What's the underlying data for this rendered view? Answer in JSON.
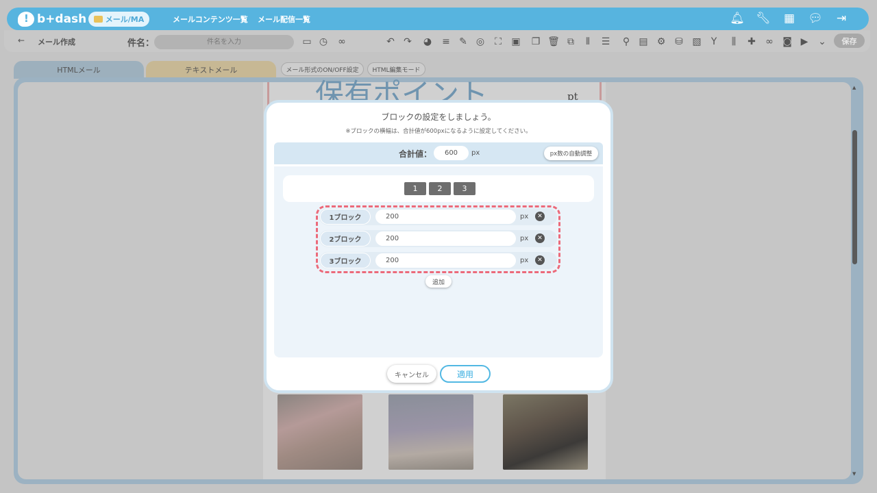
{
  "app": {
    "logo_text": "b+dash",
    "nav_pill": "メール/MA",
    "nav_links": [
      "メールコンテンツ一覧",
      "メール配信一覧"
    ],
    "top_icons": [
      "bell-icon",
      "wrench-icon",
      "grid-icon",
      "chat-icon",
      "logout-icon"
    ]
  },
  "subbar": {
    "back_glyph": "←",
    "page_title": "メール作成",
    "subject_label": "件名：",
    "subject_placeholder": "件名を入力",
    "save_label": "保存"
  },
  "tabs": {
    "html": "HTMLメール",
    "text": "テキストメール",
    "toggle_format": "メール形式のON/OFF設定",
    "html_edit_mode": "HTML編集モード"
  },
  "mail_preview": {
    "heading": "保有ポイント",
    "heading_suffix": "pt"
  },
  "modal": {
    "title": "ブロックの設定をしましょう。",
    "note": "※ブロックの横幅は、合計値が600pxになるように設定してください。",
    "total_label": "合計値：",
    "total_value": "600",
    "total_unit": "px",
    "auto_adjust_label": "px数の自動調整",
    "block_count_options": [
      "1",
      "2",
      "3"
    ],
    "blocks": [
      {
        "label": "1ブロック",
        "value": "200",
        "unit": "px"
      },
      {
        "label": "2ブロック",
        "value": "200",
        "unit": "px"
      },
      {
        "label": "3ブロック",
        "value": "200",
        "unit": "px"
      }
    ],
    "add_label": "追加",
    "cancel_label": "キャンセル",
    "apply_label": "適用"
  },
  "colors": {
    "brand": "#57b4df",
    "accent_dashed": "#ec6a7a",
    "apply": "#52b8e3"
  }
}
